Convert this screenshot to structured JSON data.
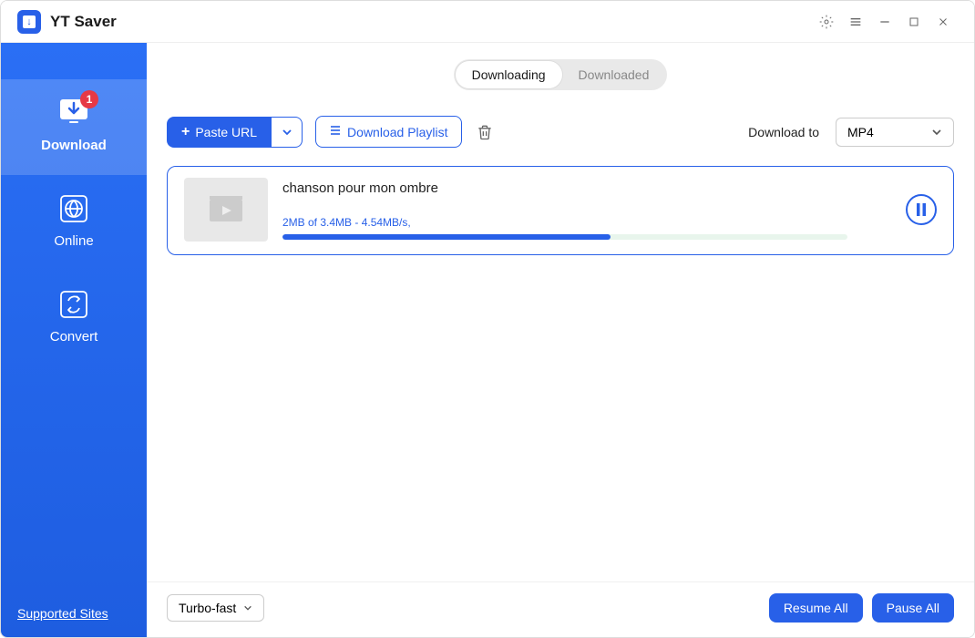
{
  "app": {
    "title": "YT Saver"
  },
  "sidebar": {
    "items": [
      {
        "label": "Download",
        "badge": "1"
      },
      {
        "label": "Online"
      },
      {
        "label": "Convert"
      }
    ],
    "supported_sites": "Supported Sites"
  },
  "tabs": {
    "downloading": "Downloading",
    "downloaded": "Downloaded"
  },
  "toolbar": {
    "paste_url": "Paste URL",
    "download_playlist": "Download Playlist",
    "download_to": "Download to",
    "format": "MP4"
  },
  "download": {
    "title": "chanson pour mon ombre",
    "progress_text": "2MB of 3.4MB -   4.54MB/s,",
    "progress_percent": 58
  },
  "footer": {
    "speed": "Turbo-fast",
    "resume_all": "Resume All",
    "pause_all": "Pause All"
  }
}
